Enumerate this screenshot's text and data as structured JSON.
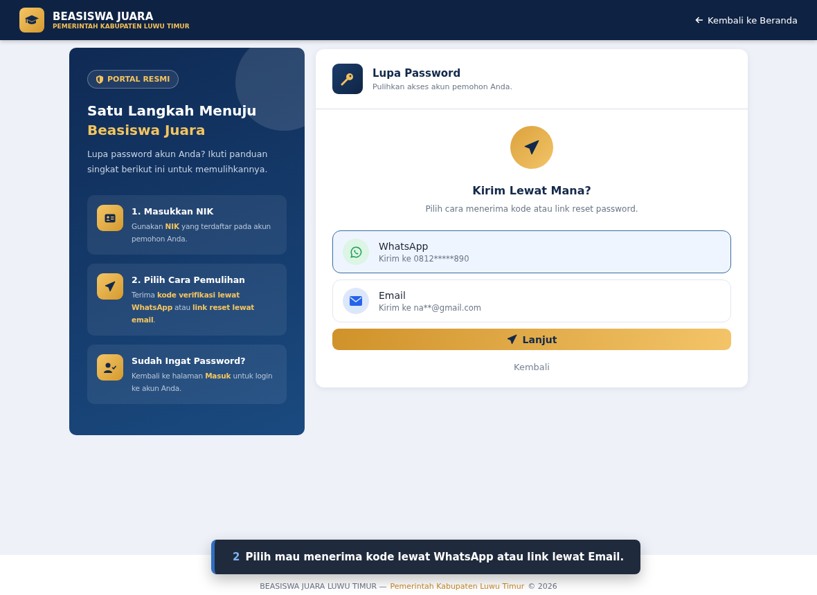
{
  "header": {
    "brand": "BEASISWA JUARA",
    "subtitle": "PEMERINTAH KABUPATEN LUWU TIMUR",
    "back_link": "Kembali ke Beranda"
  },
  "intro_panel": {
    "badge": "PORTAL RESMI",
    "title_line1": "Satu Langkah Menuju",
    "title_line2": "Beasiswa Juara",
    "description": "Lupa password akun Anda? Ikuti panduan singkat berikut ini untuk memulihkannya.",
    "steps": [
      {
        "kind": "id-card",
        "title": "1. Masukkan NIK",
        "text": "Gunakan **NIK** yang terdaftar pada akun pemohon Anda."
      },
      {
        "kind": "send",
        "title": "2. Pilih Cara Pemulihan",
        "text": "Terima **kode verifikasi lewat WhatsApp** atau **link reset lewat email**."
      },
      {
        "kind": "user-check",
        "title": "Sudah Ingat Password?",
        "text": "Kembali ke halaman **Masuk** untuk login ke akun Anda."
      }
    ]
  },
  "form_card": {
    "title": "Lupa Password",
    "subtitle": "Pulihkan akses akun pemohon Anda.",
    "heading": "Kirim Lewat Mana?",
    "hint": "Pilih cara menerima kode atau link reset password.",
    "options": [
      {
        "kind": "whatsapp",
        "label": "WhatsApp",
        "detail": "Kirim ke 0812*****890",
        "selected": true
      },
      {
        "kind": "email",
        "label": "Email",
        "detail": "Kirim ke na**@gmail.com",
        "selected": false
      }
    ],
    "submit": "Lanjut",
    "back": "Kembali"
  },
  "footer": {
    "brand": "BEASISWA JUARA LUWU TIMUR —",
    "owner": "Pemerintah Kabupaten Luwu Timur",
    "copyright": "© 2026"
  },
  "toast": {
    "step": "2",
    "message": "Pilih mau menerima kode lewat WhatsApp atau link lewat Email."
  }
}
